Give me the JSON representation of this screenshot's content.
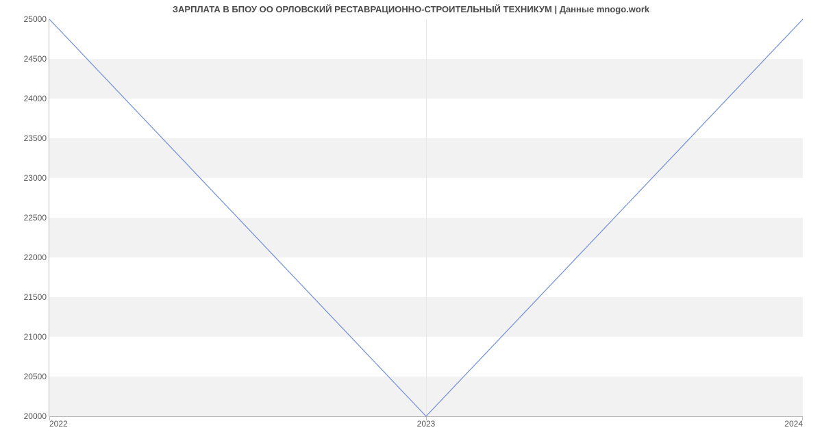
{
  "chart_data": {
    "type": "line",
    "title": "ЗАРПЛАТА В БПОУ ОО ОРЛОВСКИЙ РЕСТАВРАЦИОННО-СТРОИТЕЛЬНЫЙ ТЕХНИКУМ | Данные mnogo.work",
    "xlabel": "",
    "ylabel": "",
    "x": [
      2022,
      2023,
      2024
    ],
    "values": [
      25000,
      20000,
      25000
    ],
    "x_ticks": [
      "2022",
      "2023",
      "2024"
    ],
    "y_ticks": [
      20000,
      20500,
      21000,
      21500,
      22000,
      22500,
      23000,
      23500,
      24000,
      24500,
      25000
    ],
    "xlim": [
      2022,
      2024
    ],
    "ylim": [
      20000,
      25000
    ],
    "line_color": "#6f8fd8",
    "band_color": "#f2f2f2"
  }
}
